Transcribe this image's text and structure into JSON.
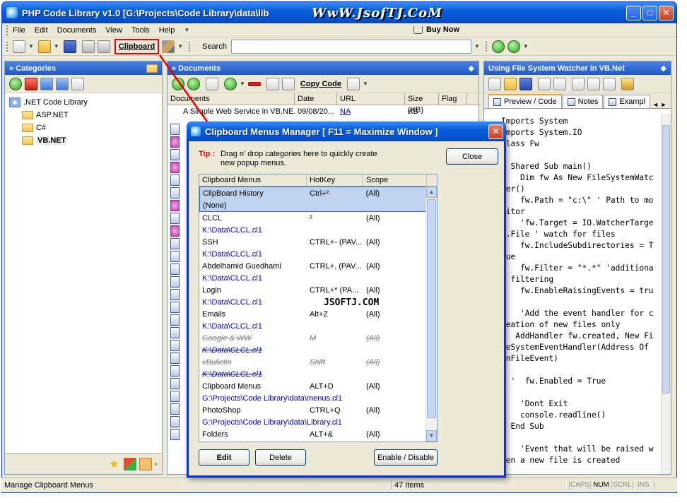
{
  "window": {
    "title": "PHP Code Library v1.0 [G:\\Projects\\Code Library\\data\\lib",
    "watermark": "WwW.JsofTJ.CoM"
  },
  "menu": [
    "File",
    "Edit",
    "Documents",
    "View",
    "Tools",
    "Help"
  ],
  "buy_now": "Buy Now",
  "toolbar": {
    "clipboard_label": "Clipboard",
    "search_label": "Search",
    "search_value": ""
  },
  "categories": {
    "header": "» Categories",
    "root": ".NET Code Library",
    "items": [
      "ASP.NET",
      "C#",
      "VB.NET"
    ]
  },
  "documents": {
    "header": "» Documents",
    "copy_code": "Copy Code",
    "columns": [
      "Documents",
      "Date",
      "URL",
      "Size (KB)",
      "Flag"
    ],
    "rows": [
      {
        "name": "A Simple Web Service in VB.NE...",
        "date": "09/08/20...",
        "url": "NA",
        "size": "KB",
        "flag": ""
      }
    ]
  },
  "code_pane": {
    "header": "Using File System Watcher in VB.Net",
    "tabs": [
      "Preview / Code",
      "Notes",
      "Exampl"
    ],
    "lines": [
      "Imports System",
      "Imports System.IO",
      "Class Fw",
      "",
      "  Shared Sub main()",
      "    Dim fw As New FileSystemWatcher()",
      "    fw.Path = \"c:\\\" ' Path to monitor",
      "    'fw.Target = IO.WatcherTarget.File ' watch for files",
      "    fw.IncludeSubdirectories = True",
      "    fw.Filter = \"*.*\" 'additional filtering",
      "    fw.EnableRaisingEvents = true",
      "    'Add the event handler for creation of new files only",
      "   AddHandler fw.created, New FileSystemEventHandler(Address Of OnFileEvent)",
      "",
      "  '  fw.Enabled = True",
      "",
      "    'Dont Exit",
      "    console.readline()",
      "  End Sub",
      "",
      "    'Event that will be raised when a new file is created"
    ]
  },
  "status": {
    "message": "Manage Clipboard Menus",
    "count": "47 Items",
    "indicators": [
      {
        "label": "CAPS",
        "on": false
      },
      {
        "label": "NUM",
        "on": true
      },
      {
        "label": "SCRL",
        "on": false
      },
      {
        "label": "INS",
        "on": false
      }
    ]
  },
  "dialog": {
    "title": "Clipboard Menus Manager [ F11 = Maximize Window ]",
    "tip_label": "Tip :",
    "tip_text": "Drag n' drop categories here to quickly create new popup menus.",
    "close_label": "Close",
    "columns": [
      "Clipboard Menus",
      "HotKey",
      "Scope"
    ],
    "overlay_text": "JSOFTJ.COM",
    "entries": [
      {
        "name": "ClipBoard History",
        "hotkey": "Ctrl+²",
        "scope": "(All)",
        "path": "(None)",
        "state": "selected"
      },
      {
        "name": "CLCL",
        "hotkey": "²",
        "scope": "(All)",
        "path": "K:\\Data\\CLCL.cl1",
        "state": "normal"
      },
      {
        "name": "SSH",
        "hotkey": "CTRL+- (PAV...",
        "scope": "(All)",
        "path": "K:\\Data\\CLCL.cl1",
        "state": "normal"
      },
      {
        "name": "Abdelhamid Guedhami",
        "hotkey": "CTRL+. (PAV...",
        "scope": "(All)",
        "path": "K:\\Data\\CLCL.cl1",
        "state": "normal"
      },
      {
        "name": "Login",
        "hotkey": "CTRL+* (PA...",
        "scope": "(All)",
        "path": "K:\\Data\\CLCL.cl1",
        "state": "normal"
      },
      {
        "name": "Emails",
        "hotkey": "Alt+Z",
        "scope": "(All)",
        "path": "K:\\Data\\CLCL.cl1",
        "state": "normal"
      },
      {
        "name": "Google & WW",
        "hotkey": "M",
        "scope": "(All)",
        "path": "K:\\Data\\CLCL.cl1",
        "state": "disabled"
      },
      {
        "name": "vBulletin",
        "hotkey": "Shift",
        "scope": "(All)",
        "path": "K:\\Data\\CLCL.cl1",
        "state": "disabled"
      },
      {
        "name": "Clipboard Menus",
        "hotkey": "ALT+D",
        "scope": "(All)",
        "path": "G:\\Projects\\Code Library\\data\\menus.cl1",
        "state": "normal"
      },
      {
        "name": "PhotoShop",
        "hotkey": "CTRL+Q",
        "scope": "(All)",
        "path": "G:\\Projects\\Code Library\\data\\Library.cl1",
        "state": "normal"
      },
      {
        "name": "Folders",
        "hotkey": "ALT+&",
        "scope": "(All)",
        "path": "",
        "state": "normal"
      }
    ],
    "buttons": {
      "edit": "Edit",
      "delete": "Delete",
      "toggle": "Enable / Disable"
    }
  }
}
